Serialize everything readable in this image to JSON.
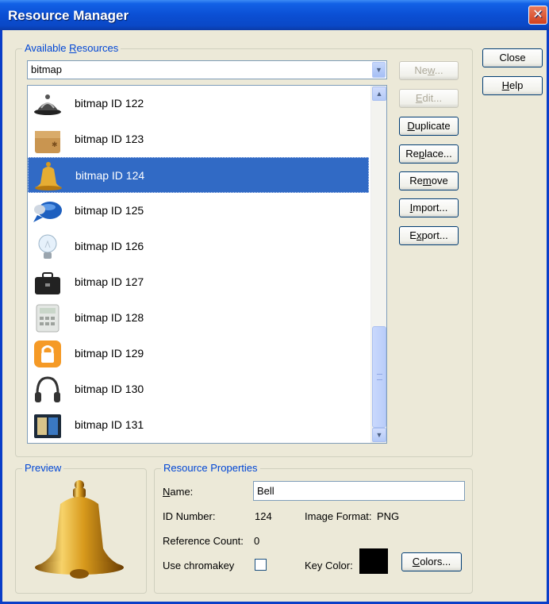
{
  "window": {
    "title": "Resource Manager",
    "close_glyph": "✕"
  },
  "available": {
    "label_before": "Available ",
    "label_accel": "R",
    "label_after": "esources",
    "combo_value": "bitmap",
    "items": [
      {
        "label": "bitmap ID 122",
        "icon": "service-bell-icon"
      },
      {
        "label": "bitmap ID 123",
        "icon": "cardboard-box-icon"
      },
      {
        "label": "bitmap ID 124",
        "icon": "bell-icon",
        "selected": true
      },
      {
        "label": "bitmap ID 125",
        "icon": "speech-bubble-icon"
      },
      {
        "label": "bitmap ID 126",
        "icon": "lightbulb-icon"
      },
      {
        "label": "bitmap ID 127",
        "icon": "briefcase-icon"
      },
      {
        "label": "bitmap ID 128",
        "icon": "calculator-icon"
      },
      {
        "label": "bitmap ID 129",
        "icon": "padlock-icon"
      },
      {
        "label": "bitmap ID 130",
        "icon": "headphones-icon"
      },
      {
        "label": "bitmap ID 131",
        "icon": "book-icon"
      }
    ]
  },
  "buttons": {
    "new": {
      "pre": "Ne",
      "acc": "w",
      "post": "..."
    },
    "edit": {
      "pre": "",
      "acc": "E",
      "post": "dit..."
    },
    "duplicate": {
      "pre": "",
      "acc": "D",
      "post": "uplicate"
    },
    "replace": {
      "pre": "Re",
      "acc": "p",
      "post": "lace..."
    },
    "remove": {
      "pre": "Re",
      "acc": "m",
      "post": "ove"
    },
    "import": {
      "pre": "",
      "acc": "I",
      "post": "mport..."
    },
    "export": {
      "pre": "E",
      "acc": "x",
      "post": "port..."
    },
    "close": "Close",
    "help": {
      "pre": "",
      "acc": "H",
      "post": "elp"
    },
    "colors": {
      "pre": "",
      "acc": "C",
      "post": "olors..."
    }
  },
  "preview": {
    "label": "Preview",
    "icon": "bell-icon"
  },
  "properties": {
    "label": "Resource Properties",
    "name_label": {
      "pre": "",
      "acc": "N",
      "post": "ame:"
    },
    "name_value": "Bell",
    "id_label": "ID Number:",
    "id_value": "124",
    "format_label": "Image Format:",
    "format_value": "PNG",
    "refcount_label": "Reference Count:",
    "refcount_value": "0",
    "chromakey_label": "Use chromakey",
    "chromakey_checked": false,
    "keycolor_label": "Key Color:",
    "keycolor_value": "#000000"
  },
  "colors": {
    "selection": "#316ac5",
    "group_label": "#0046d5",
    "title_bar": "#0b4fd4"
  }
}
